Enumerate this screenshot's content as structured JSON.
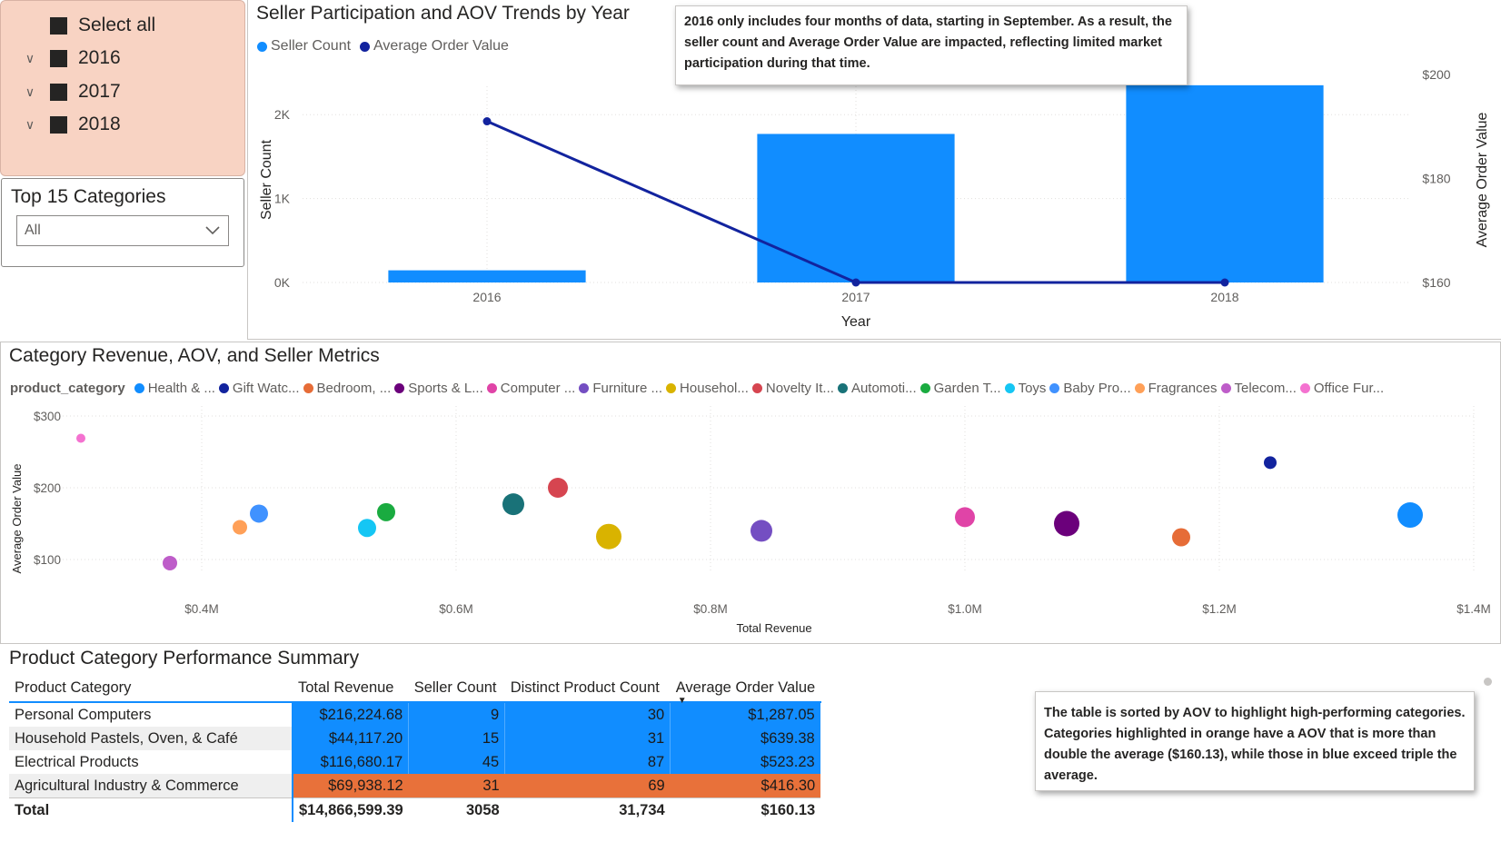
{
  "year_slicer": {
    "select_all": "Select all",
    "years": [
      "2016",
      "2017",
      "2018"
    ]
  },
  "category_filter": {
    "title": "Top 15 Categories",
    "selected": "All"
  },
  "seller_chart": {
    "title": "Seller Participation and AOV Trends by Year",
    "legend": [
      "Seller Count",
      "Average Order Value"
    ],
    "tooltip": "2016 only includes four months of data, starting in September. As a result, the seller count and Average Order Value are impacted, reflecting limited market participation during that time.",
    "x_label": "Year",
    "y_left_label": "Seller Count",
    "y_right_label": "Average Order Value",
    "y_left_ticks": [
      "0K",
      "1K",
      "2K"
    ],
    "y_right_ticks": [
      "$160",
      "$180",
      "$200"
    ],
    "colors": {
      "bars": "#118dff",
      "line": "#12239e"
    }
  },
  "scatter_chart": {
    "title": "Category Revenue, AOV, and Seller Metrics",
    "legend_title": "product_category",
    "legend": [
      {
        "label": "Health & ...",
        "color": "#118dff"
      },
      {
        "label": "Gift Watc...",
        "color": "#12239e"
      },
      {
        "label": "Bedroom, ...",
        "color": "#e66c37"
      },
      {
        "label": "Sports & L...",
        "color": "#6b007b"
      },
      {
        "label": "Computer ...",
        "color": "#e044a7"
      },
      {
        "label": "Furniture ...",
        "color": "#744ec2"
      },
      {
        "label": "Househol...",
        "color": "#d9b300"
      },
      {
        "label": "Novelty It...",
        "color": "#d64550"
      },
      {
        "label": "Automoti...",
        "color": "#197278"
      },
      {
        "label": "Garden T...",
        "color": "#1aab40"
      },
      {
        "label": "Toys",
        "color": "#15c6f4"
      },
      {
        "label": "Baby Pro...",
        "color": "#4092ff"
      },
      {
        "label": "Fragrances",
        "color": "#ffa058"
      },
      {
        "label": "Telecom...",
        "color": "#be5dc9"
      },
      {
        "label": "Office Fur...",
        "color": "#f472d0"
      }
    ],
    "x_label": "Total Revenue",
    "y_label": "Average Order Value",
    "x_ticks": [
      "$0.4M",
      "$0.6M",
      "$0.8M",
      "$1.0M",
      "$1.2M",
      "$1.4M"
    ],
    "y_ticks": [
      "$100",
      "$200",
      "$300"
    ]
  },
  "chart_data": [
    {
      "type": "bar",
      "title": "Seller Participation and AOV Trends by Year",
      "xlabel": "Year",
      "categories": [
        "2016",
        "2017",
        "2018"
      ],
      "series": [
        {
          "name": "Seller Count",
          "type": "bar",
          "axis": "left",
          "values": [
            145,
            1770,
            2350
          ]
        },
        {
          "name": "Average Order Value",
          "type": "line",
          "axis": "right",
          "values": [
            191,
            160,
            160
          ]
        }
      ],
      "ylabel_left": "Seller Count",
      "ylabel_right": "Average Order Value",
      "ylim_left": [
        0,
        2500
      ],
      "ylim_right": [
        160,
        200
      ],
      "grid": true,
      "legend_position": "top-left"
    },
    {
      "type": "scatter",
      "title": "Category Revenue, AOV, and Seller Metrics",
      "xlabel": "Total Revenue",
      "ylabel": "Average Order Value",
      "xlim": [
        0.3,
        1.4
      ],
      "ylim": [
        70,
        310
      ],
      "grid": true,
      "legend_position": "top",
      "points": [
        {
          "name": "Health & ...",
          "x": 1.35,
          "y": 162,
          "size": 14,
          "color": "#118dff"
        },
        {
          "name": "Gift Watc...",
          "x": 1.24,
          "y": 235,
          "size": 7,
          "color": "#12239e"
        },
        {
          "name": "Bedroom, ...",
          "x": 1.17,
          "y": 131,
          "size": 10,
          "color": "#e66c37"
        },
        {
          "name": "Sports & L...",
          "x": 1.08,
          "y": 150,
          "size": 14,
          "color": "#6b007b"
        },
        {
          "name": "Computer ...",
          "x": 1.0,
          "y": 159,
          "size": 11,
          "color": "#e044a7"
        },
        {
          "name": "Furniture ...",
          "x": 0.84,
          "y": 140,
          "size": 12,
          "color": "#744ec2"
        },
        {
          "name": "Househol...",
          "x": 0.72,
          "y": 132,
          "size": 14,
          "color": "#d9b300"
        },
        {
          "name": "Novelty It...",
          "x": 0.68,
          "y": 200,
          "size": 11,
          "color": "#d64550"
        },
        {
          "name": "Automoti...",
          "x": 0.645,
          "y": 177,
          "size": 12,
          "color": "#197278"
        },
        {
          "name": "Garden T...",
          "x": 0.545,
          "y": 166,
          "size": 10,
          "color": "#1aab40"
        },
        {
          "name": "Toys",
          "x": 0.53,
          "y": 144,
          "size": 10,
          "color": "#15c6f4"
        },
        {
          "name": "Baby Pro...",
          "x": 0.445,
          "y": 164,
          "size": 10,
          "color": "#4092ff"
        },
        {
          "name": "Fragrances",
          "x": 0.43,
          "y": 145,
          "size": 8,
          "color": "#ffa058"
        },
        {
          "name": "Telecom...",
          "x": 0.375,
          "y": 95,
          "size": 8,
          "color": "#be5dc9"
        },
        {
          "name": "Office Fur...",
          "x": 0.305,
          "y": 269,
          "size": 5,
          "color": "#f472d0"
        }
      ]
    }
  ],
  "summary_table": {
    "title": "Product Category Performance Summary",
    "columns": [
      "Product Category",
      "Total Revenue",
      "Seller Count",
      "Distinct Product Count",
      "Average Order Value"
    ],
    "rows": [
      {
        "category": "Personal Computers",
        "revenue": "$216,224.68",
        "sellers": "9",
        "products": "30",
        "aov": "$1,287.05",
        "highlight": "blue"
      },
      {
        "category": "Household Pastels, Oven, & Café",
        "revenue": "$44,117.20",
        "sellers": "15",
        "products": "31",
        "aov": "$639.38",
        "highlight": "blue"
      },
      {
        "category": "Electrical Products",
        "revenue": "$116,680.17",
        "sellers": "45",
        "products": "87",
        "aov": "$523.23",
        "highlight": "blue"
      },
      {
        "category": "Agricultural Industry & Commerce",
        "revenue": "$69,938.12",
        "sellers": "31",
        "products": "69",
        "aov": "$416.30",
        "highlight": "orange"
      }
    ],
    "total": {
      "label": "Total",
      "revenue": "$14,866,599.39",
      "sellers": "3058",
      "products": "31,734",
      "aov": "$160.13"
    },
    "tooltip": "The table is sorted by AOV to highlight high-performing categories. Categories highlighted in orange have a AOV that is more than double the average ($160.13), while those in blue exceed triple the average."
  }
}
